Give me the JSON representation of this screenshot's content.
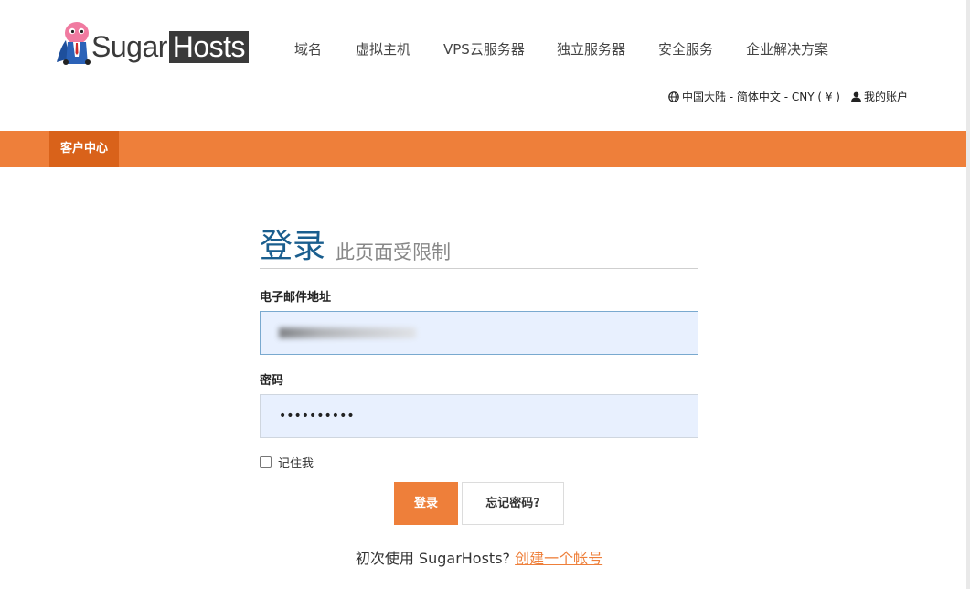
{
  "brand": {
    "name_left": "Sugar",
    "name_right": "Hosts"
  },
  "nav": {
    "items": [
      "域名",
      "虚拟主机",
      "VPS云服务器",
      "独立服务器",
      "安全服务",
      "企业解决方案"
    ]
  },
  "utility": {
    "locale": "中国大陆 - 简体中文 - CNY ( ¥ )",
    "account": "我的账户"
  },
  "subnav": {
    "active_tab": "客户中心"
  },
  "login": {
    "title": "登录",
    "subtitle": "此页面受限制",
    "email_label": "电子邮件地址",
    "email_value": "",
    "password_label": "密码",
    "password_value": "••••••••••",
    "remember_label": "记住我",
    "login_button": "登录",
    "forgot_button": "忘记密码?",
    "signup_prompt": "初次使用 SugarHosts?",
    "signup_link": "创建一个帐号"
  },
  "colors": {
    "accent": "#ee7f3a",
    "accent_dark": "#d9621a",
    "title_blue": "#1a5e8e",
    "input_bg": "#e8f0fe"
  },
  "icons": {
    "globe": "globe-icon",
    "user": "user-icon"
  }
}
